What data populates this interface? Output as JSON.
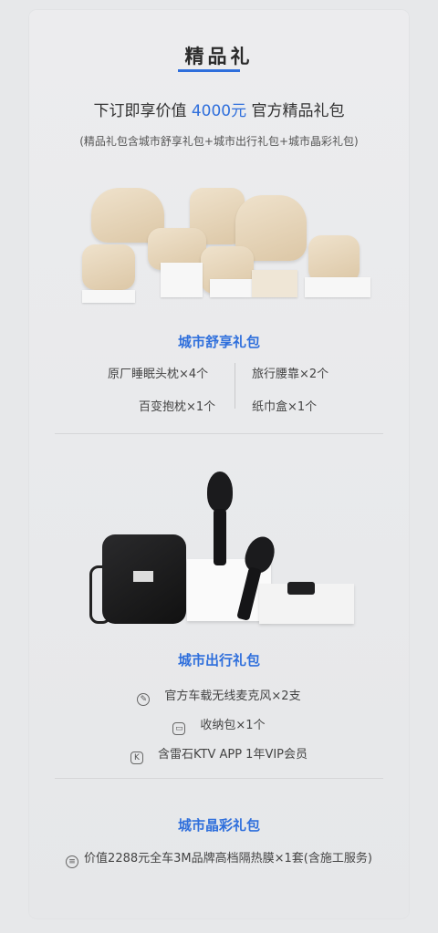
{
  "header": {
    "title": "精品礼",
    "headline_before": "下订即享价值 ",
    "headline_accent": "4000元",
    "headline_after": " 官方精品礼包",
    "subline": "(精品礼包含城市舒享礼包+城市出行礼包+城市晶彩礼包)"
  },
  "section1": {
    "title": "城市舒享礼包",
    "items": [
      "原厂睡眠头枕×4个",
      "旅行腰靠×2个",
      "百变抱枕×1个",
      "纸巾盒×1个"
    ]
  },
  "section2": {
    "title": "城市出行礼包",
    "items": [
      {
        "icon": "microphone-icon",
        "text": "官方车载无线麦克风×2支"
      },
      {
        "icon": "bag-icon",
        "text": "收纳包×1个"
      },
      {
        "icon": "k-icon",
        "text": "含雷石KTV APP 1年VIP会员"
      }
    ]
  },
  "section3": {
    "title": "城市晶彩礼包",
    "items": [
      {
        "icon": "film-roll-icon",
        "text": "价值2288元全车3M品牌高档隔热膜×1套(含施工服务)"
      }
    ]
  },
  "colors": {
    "accent": "#2f6fdc",
    "background": "#e7e8ea"
  }
}
